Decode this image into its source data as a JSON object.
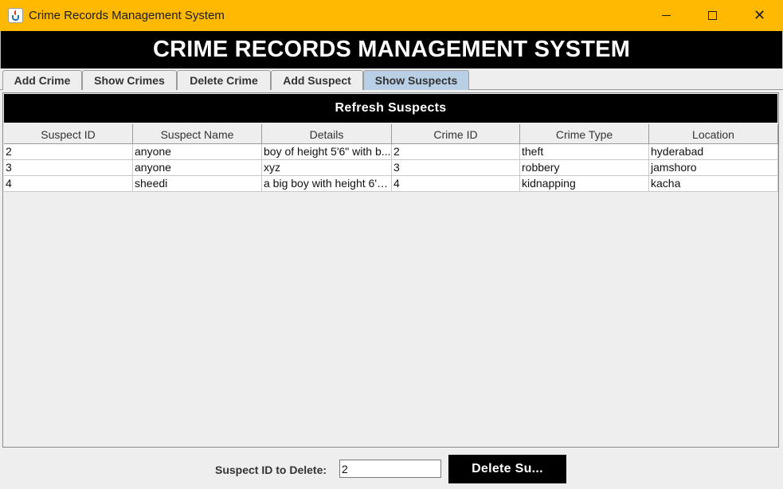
{
  "window": {
    "title": "Crime Records Management System",
    "close_glyph": "✕"
  },
  "banner": {
    "title": "CRIME RECORDS MANAGEMENT SYSTEM"
  },
  "tabs": [
    {
      "label": "Add Crime",
      "active": false
    },
    {
      "label": "Show Crimes",
      "active": false
    },
    {
      "label": "Delete Crime",
      "active": false
    },
    {
      "label": "Add Suspect",
      "active": false
    },
    {
      "label": "Show Suspects",
      "active": true
    }
  ],
  "panel": {
    "refresh_label": "Refresh Suspects"
  },
  "table": {
    "columns": [
      "Suspect ID",
      "Suspect Name",
      "Details",
      "Crime ID",
      "Crime Type",
      "Location"
    ],
    "rows": [
      [
        "2",
        "anyone",
        "boy of height 5'6\" with b...",
        "2",
        "theft",
        "hyderabad"
      ],
      [
        "3",
        "anyone",
        "xyz",
        "3",
        "robbery",
        "jamshoro"
      ],
      [
        "4",
        "sheedi",
        "a big boy with height 6'5...",
        "4",
        "kidnapping",
        "kacha"
      ]
    ]
  },
  "delete_form": {
    "label": "Suspect ID to Delete:",
    "value": "2",
    "button_label": "Delete Su..."
  },
  "colors": {
    "titlebar": "#ffb900",
    "banner": "#000000",
    "active_tab": "#b8cfe5"
  },
  "icons": {
    "app": "java-icon",
    "minimize": "minimize-icon",
    "maximize": "maximize-icon",
    "close": "close-icon"
  }
}
